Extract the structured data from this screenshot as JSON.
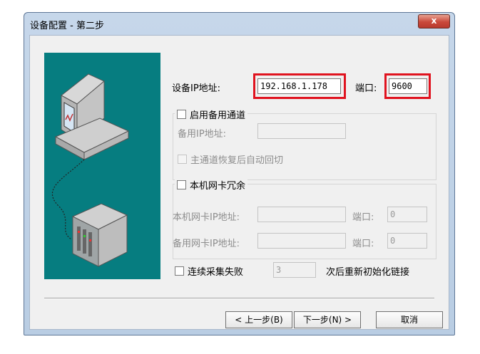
{
  "window": {
    "title": "设备配置 - 第二步",
    "close_glyph": "x"
  },
  "device": {
    "ip_label": "设备IP地址:",
    "ip_value": "192.168.1.178",
    "port_label": "端口:",
    "port_value": "9600"
  },
  "backup_channel": {
    "enable_label": "启用备用通道",
    "ip_label": "备用IP地址:",
    "ip_value": "",
    "auto_switch_label": "主通道恢复后自动回切"
  },
  "nic_redundancy": {
    "label": "本机网卡冗余",
    "local_ip_label": "本机网卡IP地址:",
    "local_port_label": "端口:",
    "local_port_value": "0",
    "backup_ip_label": "备用网卡IP地址:",
    "backup_port_label": "端口:",
    "backup_port_value": "0"
  },
  "reinit": {
    "prefix_label": "连续采集失败",
    "count_value": "3",
    "suffix_label": "次后重新初始化链接"
  },
  "buttons": {
    "prev": "< 上一步(B)",
    "next": "下一步(N) >",
    "cancel": "取消"
  },
  "colors": {
    "highlight": "#e0131f",
    "art_bg": "#067d80"
  }
}
